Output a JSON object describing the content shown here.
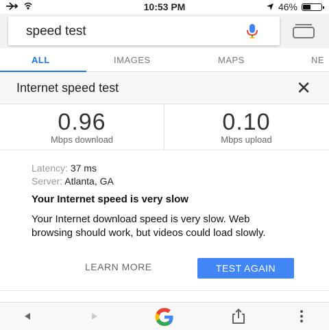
{
  "status": {
    "time": "10:53 PM",
    "battery": "46%",
    "battery_level": 0.46
  },
  "search": {
    "query": "speed test",
    "mic_icon": "mic-icon",
    "tabs_icon": "tabs-icon"
  },
  "nav": {
    "tabs": [
      {
        "label": "ALL",
        "active": true
      },
      {
        "label": "IMAGES",
        "active": false
      },
      {
        "label": "MAPS",
        "active": false
      },
      {
        "label": "NE",
        "active": false
      }
    ]
  },
  "card": {
    "title": "Internet speed test",
    "download": {
      "value": "0.96",
      "unit": "Mbps download"
    },
    "upload": {
      "value": "0.10",
      "unit": "Mbps upload"
    },
    "latency_label": "Latency:",
    "latency_value": "37 ms",
    "server_label": "Server:",
    "server_value": "Atlanta, GA",
    "verdict": "Your Internet speed is very slow",
    "description": "Your Internet download speed is very slow. Web browsing should work, but videos could load slowly.",
    "learn_more": "LEARN MORE",
    "test_again": "TEST AGAIN"
  },
  "colors": {
    "accent": "#4285f4",
    "active_tab": "#1a73e8"
  }
}
